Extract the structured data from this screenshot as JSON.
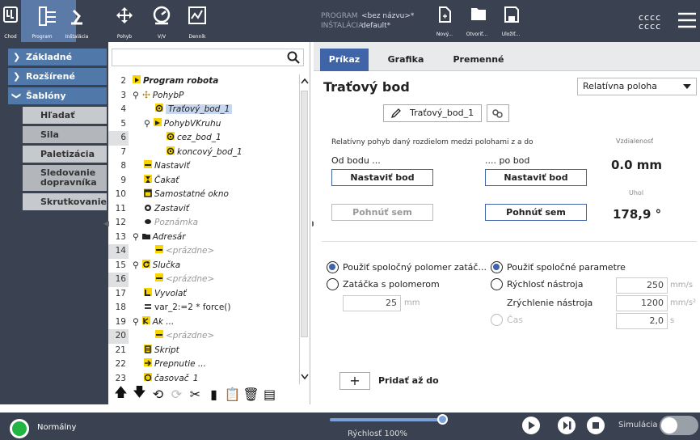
{
  "topbar": {
    "items": [
      {
        "label": "Chod"
      },
      {
        "label": "Program"
      },
      {
        "label": "Inštalácia"
      },
      {
        "label": "Pohyb"
      },
      {
        "label": "V/V"
      },
      {
        "label": "Denník"
      }
    ],
    "program_label": "PROGRAM",
    "program_value": "<bez názvu>*",
    "installation_label": "INŠTALÁCIA",
    "installation_value": "default*",
    "file_buttons": [
      {
        "label": "Nový..."
      },
      {
        "label": "Otvoriť..."
      },
      {
        "label": "Uložiť..."
      }
    ],
    "user_line1": "cccc",
    "user_line2": "cccc"
  },
  "leftnav": {
    "categories": [
      {
        "label": "Základné"
      },
      {
        "label": "Rozšírené"
      },
      {
        "label": "Šablóny"
      }
    ],
    "sub_items": [
      {
        "label": "Hľadať"
      },
      {
        "label": "Sila"
      },
      {
        "label": "Paletizácia"
      },
      {
        "label": "Sledovanie dopravníka"
      },
      {
        "label": "Skrutkovanie"
      }
    ]
  },
  "tree": {
    "rows": [
      {
        "num": "2",
        "text": "Program robota"
      },
      {
        "num": "3",
        "text": "PohybP"
      },
      {
        "num": "4",
        "text": "Traťový_bod_1"
      },
      {
        "num": "5",
        "text": "PohybVKruhu"
      },
      {
        "num": "6",
        "text": "cez_bod_1"
      },
      {
        "num": "7",
        "text": "koncový_bod_1"
      },
      {
        "num": "8",
        "text": "Nastaviť"
      },
      {
        "num": "9",
        "text": "Čakať"
      },
      {
        "num": "10",
        "text": "Samostatné okno"
      },
      {
        "num": "11",
        "text": "Zastaviť"
      },
      {
        "num": "12",
        "text": "Poznámka"
      },
      {
        "num": "13",
        "text": "Adresár"
      },
      {
        "num": "14",
        "text": "<prázdne>"
      },
      {
        "num": "15",
        "text": "Slučka"
      },
      {
        "num": "16",
        "text": "<prázdne>"
      },
      {
        "num": "17",
        "text": "Vyvolať"
      },
      {
        "num": "18",
        "text": "var_2:=2 * force()"
      },
      {
        "num": "19",
        "text": "Ak ..."
      },
      {
        "num": "20",
        "text": "<prázdne>"
      },
      {
        "num": "21",
        "text": "Skript"
      },
      {
        "num": "22",
        "text": "Prepnutie ..."
      },
      {
        "num": "23",
        "text": "časovač_1"
      }
    ]
  },
  "tabs": [
    {
      "label": "Príkaz"
    },
    {
      "label": "Grafika"
    },
    {
      "label": "Premenné"
    }
  ],
  "command": {
    "title": "Traťový bod",
    "position_mode": "Relatívna poloha",
    "waypoint_name": "Traťový_bod_1",
    "description": "Relatívny pohyb daný rozdielom medzi polohami z a do",
    "from_label": "Od bodu ...",
    "to_label": ".... po bod",
    "set_point_label": "Nastaviť bod",
    "move_here_label": "Pohnúť sem",
    "distance_label": "Vzdialenosť",
    "distance_value": "0.0 mm",
    "angle_label": "Uhol",
    "angle_value": "178,9 °",
    "blend_common": "Použiť spoločný polomer zatáč...",
    "blend_radius": "Zatáčka s polomerom",
    "blend_value": "25",
    "blend_unit": "mm",
    "params_common": "Použiť spoločné parametre",
    "tool_speed": "Rýchlosť nástroja",
    "tool_speed_value": "250",
    "tool_speed_unit": "mm/s",
    "tool_accel": "Zrýchlenie nástroja",
    "tool_accel_value": "1200",
    "tool_accel_unit": "mm/s²",
    "time_label": "Čas",
    "time_value": "2,0",
    "time_unit": "s",
    "add_until_label": "Pridať až do"
  },
  "bottombar": {
    "status": "Normálny",
    "speed_label": "Rýchlosť 100%",
    "speed_fraction": 1.0,
    "simulation_label": "Simulácia"
  }
}
